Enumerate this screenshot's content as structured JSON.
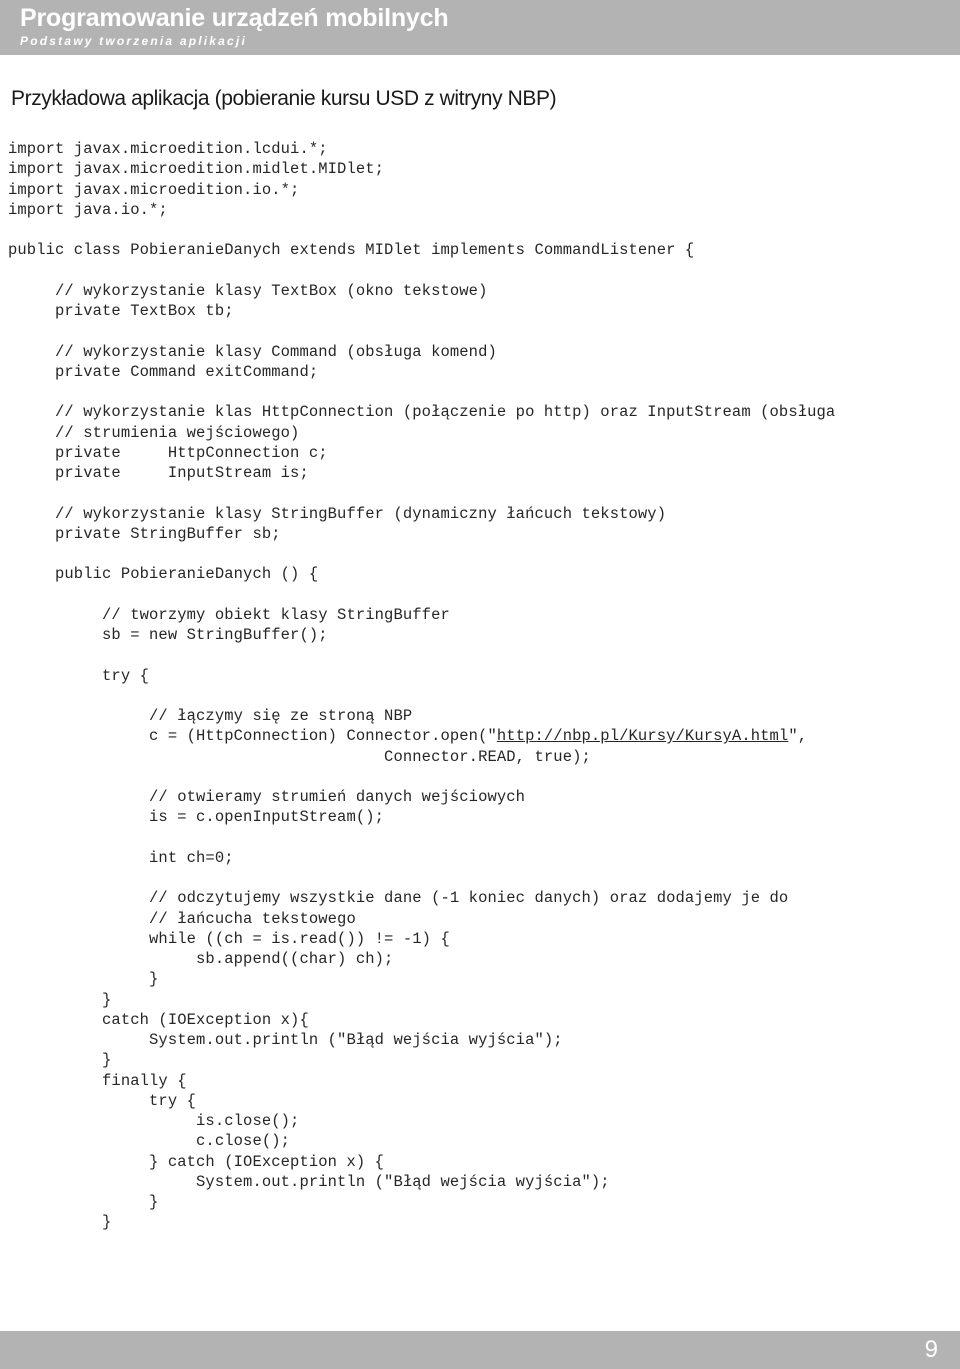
{
  "header": {
    "title": "Programowanie urządzeń mobilnych",
    "subtitle": "Podstawy tworzenia aplikacji",
    "background_color": "#b3b3b3",
    "text_color": "#ffffff"
  },
  "page": {
    "heading": "Przykładowa aplikacja (pobieranie kursu USD z witryny NBP)",
    "number": "9"
  },
  "code": {
    "language": "java",
    "url_link": "http://nbp.pl/Kursy/KursyA.html",
    "lines": [
      "import javax.microedition.lcdui.*;",
      "import javax.microedition.midlet.MIDlet;",
      "import javax.microedition.io.*;",
      "import java.io.*;",
      "",
      "public class PobieranieDanych extends MIDlet implements CommandListener {",
      "",
      "     // wykorzystanie klasy TextBox (okno tekstowe)",
      "     private TextBox tb;",
      "",
      "     // wykorzystanie klasy Command (obsługa komend)",
      "     private Command exitCommand;",
      "",
      "     // wykorzystanie klas HttpConnection (połączenie po http) oraz InputStream (obsługa",
      "     // strumienia wejściowego)",
      "     private     HttpConnection c;",
      "     private     InputStream is;",
      "",
      "     // wykorzystanie klasy StringBuffer (dynamiczny łańcuch tekstowy)",
      "     private StringBuffer sb;",
      "",
      "     public PobieranieDanych () {",
      "",
      "          // tworzymy obiekt klasy StringBuffer",
      "          sb = new StringBuffer();",
      "",
      "          try {",
      "",
      "               // łączymy się ze stroną NBP",
      "               c = (HttpConnection) Connector.open(\"http://nbp.pl/Kursy/KursyA.html\",",
      "                                        Connector.READ, true);",
      "",
      "               // otwieramy strumień danych wejściowych",
      "               is = c.openInputStream();",
      "",
      "               int ch=0;",
      "",
      "               // odczytujemy wszystkie dane (-1 koniec danych) oraz dodajemy je do",
      "               // łańcucha tekstowego",
      "               while ((ch = is.read()) != -1) {",
      "                    sb.append((char) ch);",
      "               }",
      "          }",
      "          catch (IOException x){",
      "               System.out.println (\"Błąd wejścia wyjścia\");",
      "          }",
      "          finally {",
      "               try {",
      "                    is.close();",
      "                    c.close();",
      "               } catch (IOException x) {",
      "                    System.out.println (\"Błąd wejścia wyjścia\");",
      "               }",
      "          }"
    ]
  }
}
